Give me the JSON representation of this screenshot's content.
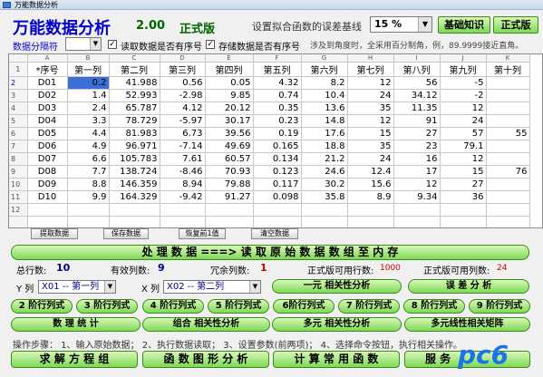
{
  "window": {
    "title": "万能数据分析"
  },
  "header": {
    "app_title": "万能数据分析",
    "version": "2.00",
    "edition": "正式版",
    "err_label": "设置拟合函数的误差基线",
    "err_value": "15 %",
    "btn_basic": "基础知识",
    "btn_pro": "正式版"
  },
  "options": {
    "sep_label": "数据分隔符",
    "chk1_label": "读取数据是否有序号",
    "chk2_label": "存储数据是否有序号",
    "hint": "涉及到角度时，全采用百分制角，例，89.9999接近直角。"
  },
  "grid": {
    "letters": [
      "",
      "A",
      "B",
      "C",
      "D",
      "E",
      "F",
      "G",
      "H",
      "I",
      "J",
      "K"
    ],
    "headers": [
      "*序号",
      "第一列",
      "第二列",
      "第三列",
      "第四列",
      "第五列",
      "第六列",
      "第七列",
      "第八列",
      "第九列",
      "第十列"
    ],
    "row_numbers": [
      "1",
      "2",
      "3",
      "4",
      "5",
      "6",
      "7",
      "8",
      "9",
      "10",
      "11",
      "12"
    ],
    "rows": [
      [
        "D01",
        "0.2",
        "41.988",
        "0.56",
        "0.05",
        "4.32",
        "8.2",
        "12",
        "56",
        "-5",
        ""
      ],
      [
        "D02",
        "1.4",
        "52.993",
        "-2.98",
        "9.85",
        "0.74",
        "10.4",
        "24",
        "34.12",
        "-2",
        ""
      ],
      [
        "D03",
        "2.4",
        "65.787",
        "4.12",
        "20.12",
        "0.35",
        "13.6",
        "35",
        "11.35",
        "12",
        ""
      ],
      [
        "D04",
        "3.3",
        "78.729",
        "-5.97",
        "30.17",
        "0.23",
        "14.8",
        "12",
        "91",
        "24",
        ""
      ],
      [
        "D05",
        "4.4",
        "81.983",
        "6.73",
        "39.56",
        "0.19",
        "17.6",
        "15",
        "27",
        "57",
        "55"
      ],
      [
        "D06",
        "4.9",
        "96.971",
        "-7.14",
        "49.69",
        "0.165",
        "18.8",
        "35",
        "23",
        "79.1",
        ""
      ],
      [
        "D07",
        "6.6",
        "105.783",
        "7.61",
        "60.57",
        "0.134",
        "21.2",
        "24",
        "16",
        "12",
        ""
      ],
      [
        "D08",
        "7.7",
        "138.724",
        "-8.46",
        "70.93",
        "0.123",
        "24.6",
        "12.4",
        "17",
        "15",
        "76"
      ],
      [
        "D09",
        "8.8",
        "146.359",
        "8.94",
        "79.88",
        "0.117",
        "30.2",
        "15.6",
        "12",
        "27",
        ""
      ],
      [
        "D10",
        "9.9",
        "164.329",
        "-9.42",
        "91.27",
        "0.098",
        "35.8",
        "8.9",
        "9.34",
        "36",
        ""
      ],
      [
        "",
        "",
        "",
        "",
        "",
        "",
        "",
        "",
        "",
        "",
        ""
      ],
      [
        "",
        "",
        "",
        "",
        "",
        "",
        "",
        "",
        "",
        "",
        ""
      ]
    ]
  },
  "grid_buttons": {
    "extract": "提取数据",
    "save": "保存数据",
    "restore": "恢复前1值",
    "clear": "清空数据"
  },
  "process": {
    "label": "处 理 数 据 ===> 读 取 原 始 数 据 数 组 至 内 存"
  },
  "stats": {
    "total_label": "总行数:",
    "total": "10",
    "valid_label": "有效列数:",
    "valid": "9",
    "redundant_label": "冗余列数:",
    "redundant": "1",
    "rows_label": "正式版可用行数:",
    "rows": "1000",
    "cols_label": "正式版可用列数:",
    "cols": "24"
  },
  "axes": {
    "y_label": "Y 列",
    "y_value": "X01 -- 第一列",
    "x_label": "X 列",
    "x_value": "X02 -- 第二列"
  },
  "buttons": {
    "corr1": "一元 相关性分析",
    "err": "误 差 分 析",
    "p2": "2 阶行列式",
    "p3": "3 阶行列式",
    "p4": "4 阶行列式",
    "p5": "5 阶行列式",
    "p6": "6阶行列式",
    "p7": "7 阶行列式",
    "p8": "8 阶行列式",
    "p9": "9 阶行列式",
    "stats": "数 理 统 计",
    "combo": "组合 相关性分析",
    "multi": "多元 相关性分析",
    "matrix": "多元线性相关矩阵"
  },
  "steps": "操作步骤： 1、输入原始数据； 2、执行数据读取； 3、设置参数(前两项)； 4、选择命令按钮，执行相关操作。",
  "bottom": {
    "solve": "求 解 方 程 组",
    "plot": "函 数 图 形 分 析",
    "calc": "计 算 常 用 函 数",
    "service": "服 务"
  },
  "watermark": "pc6"
}
